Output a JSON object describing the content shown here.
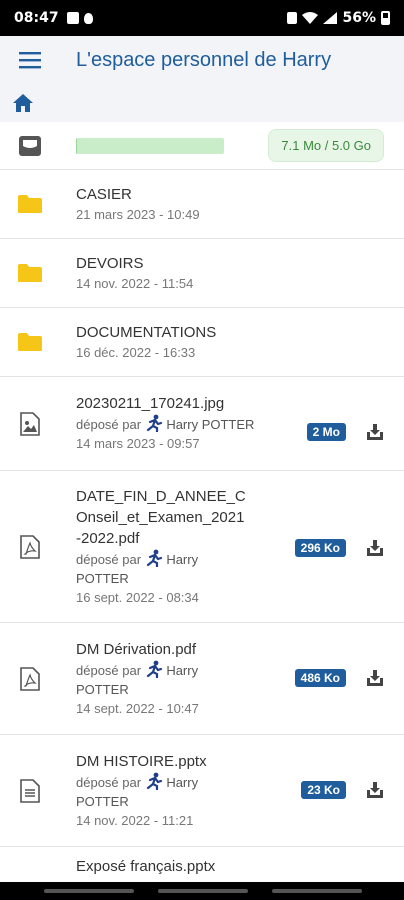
{
  "status_bar": {
    "time": "08:47",
    "battery": "56%"
  },
  "header": {
    "title": "L'espace personnel de Harry"
  },
  "quota": {
    "label": "7.1 Mo / 5.0 Go",
    "used_fraction": 0.0014
  },
  "items": [
    {
      "type": "folder",
      "name": "CASIER",
      "date": "21 mars 2023 - 10:49"
    },
    {
      "type": "folder",
      "name": "DEVOIRS",
      "date": "14 nov. 2022 - 11:54"
    },
    {
      "type": "folder",
      "name": "DOCUMENTATIONS",
      "date": "16 déc. 2022 - 16:33"
    },
    {
      "type": "image",
      "name": "20230211_170241.jpg",
      "depose_prefix": "déposé par",
      "depose_name": "Harry POTTER",
      "date": "14 mars 2023 - 09:57",
      "size": "2 Mo"
    },
    {
      "type": "pdf",
      "name_lines": [
        "DATE_FIN_D_ANNEE_C",
        "Onseil_et_Examen_2021",
        "-2022.pdf"
      ],
      "depose_prefix": "déposé par",
      "depose_name_1": "Harry",
      "depose_name_2": "POTTER",
      "date": "16 sept. 2022 - 08:34",
      "size": "296 Ko"
    },
    {
      "type": "pdf",
      "name": "DM Dérivation.pdf",
      "depose_prefix": "déposé par",
      "depose_name_1": "Harry",
      "depose_name_2": "POTTER",
      "date": "14 sept. 2022 - 10:47",
      "size": "486 Ko"
    },
    {
      "type": "doc",
      "name": "DM HISTOIRE.pptx",
      "depose_prefix": "déposé par",
      "depose_name_1": "Harry",
      "depose_name_2": "POTTER",
      "date": "14 nov. 2022 - 11:21",
      "size": "23 Ko"
    },
    {
      "type": "doc",
      "name": "Exposé français.pptx"
    }
  ],
  "colors": {
    "brand": "#1f5d9c",
    "folder": "#f5c518",
    "quota_green": "#3a8a3a"
  }
}
